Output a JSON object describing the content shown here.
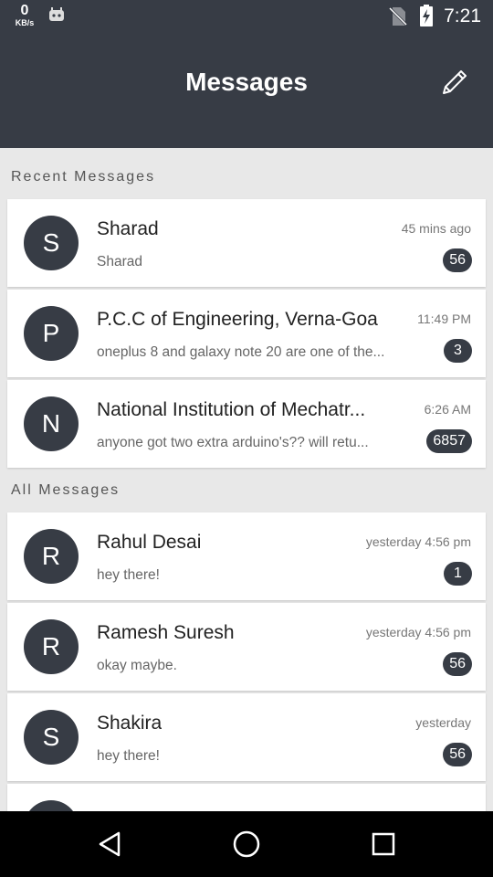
{
  "status_bar": {
    "speed_value": "0",
    "speed_unit": "KB/s",
    "time": "7:21",
    "icons": [
      "android-robot-icon",
      "no-sim-icon",
      "battery-charging-icon"
    ]
  },
  "header": {
    "title": "Messages",
    "compose_icon": "pencil-icon"
  },
  "recent": {
    "heading": "Recent Messages",
    "items": [
      {
        "initial": "S",
        "name": "Sharad",
        "time": "45 mins ago",
        "preview": "Sharad",
        "count": "56"
      },
      {
        "initial": "P",
        "name": "P.C.C of Engineering, Verna-Goa",
        "time": "11:49 PM",
        "preview": "oneplus 8 and galaxy note 20 are one of the...",
        "count": "3"
      },
      {
        "initial": "N",
        "name": "National Institution of Mechatr...",
        "time": "6:26 AM",
        "preview": "anyone got two extra arduino's?? will retu...",
        "count": "6857"
      }
    ]
  },
  "all": {
    "heading": "All Messages",
    "items": [
      {
        "initial": "R",
        "name": "Rahul Desai",
        "time": "yesterday 4:56 pm",
        "preview": "hey there!",
        "count": "1"
      },
      {
        "initial": "R",
        "name": "Ramesh Suresh",
        "time": "yesterday 4:56 pm",
        "preview": "okay maybe.",
        "count": "56"
      },
      {
        "initial": "S",
        "name": "Shakira",
        "time": "yesterday",
        "preview": "hey there!",
        "count": "56"
      }
    ]
  },
  "nav_bar": {
    "icons": [
      "back-icon",
      "home-icon",
      "recents-icon"
    ]
  },
  "colors": {
    "primary_dark": "#373c45",
    "background": "#e8e8e8",
    "card": "#ffffff"
  }
}
